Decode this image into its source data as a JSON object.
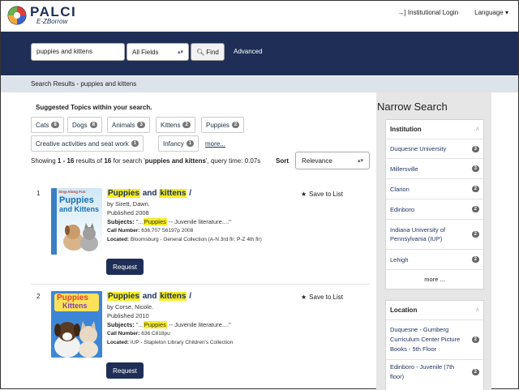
{
  "header": {
    "logo_title": "PALCI",
    "logo_subtitle": "E-ZBorrow",
    "login_label": "Institutional Login",
    "language_label": "Language"
  },
  "search": {
    "query": "puppies and kittens",
    "field": "All Fields",
    "find_label": "Find",
    "advanced_label": "Advanced"
  },
  "breadcrumb": "Search Results - puppies and kittens",
  "suggested": {
    "title": "Suggested Topics within your search.",
    "topics": [
      {
        "label": "Cats",
        "count": "8"
      },
      {
        "label": "Dogs",
        "count": "8"
      },
      {
        "label": "Animals",
        "count": "3"
      },
      {
        "label": "Kittens",
        "count": "2"
      },
      {
        "label": "Puppies",
        "count": "2"
      },
      {
        "label": "Creative activities and seat work",
        "count": "1"
      },
      {
        "label": "Infancy",
        "count": "1"
      }
    ],
    "more_label": "more..."
  },
  "results_info": {
    "showing": "Showing",
    "range": "1 - 16",
    "results_of": "results of",
    "total": "16",
    "for_search": "for search '",
    "query": "puppies and kittens",
    "query_time": "', query time: 0.07s",
    "sort_label": "Sort",
    "sort_value": "Relevance"
  },
  "results": [
    {
      "number": "1",
      "title_word1": "Puppies",
      "title_and": "and",
      "title_word2": "kittens",
      "title_end": "/",
      "author": "by Sirett, Dawn.",
      "published": "Published 2008",
      "subjects_label": "Subjects:",
      "subjects_pre": "\"...",
      "subjects_hl": "Puppies",
      "subjects_post": "-- Juvenile literature....\"",
      "call_label": "Call Number:",
      "call_value": "636.707 S6197p 2008",
      "located_label": "Located:",
      "located_value": "Bloomsburg - General Collection (A-N 3rd flr; P-Z 4th flr)",
      "save_label": "Save to List",
      "request_label": "Request",
      "cover_text": [
        "Puppies",
        "and Kittens"
      ],
      "cover_small": "Sing-Along Fun"
    },
    {
      "number": "2",
      "title_word1": "Puppies",
      "title_and": "and",
      "title_word2": "kittens",
      "title_end": "/",
      "author": "by Corse, Nicole.",
      "published": "Published 2010",
      "subjects_label": "Subjects:",
      "subjects_pre": "\"...",
      "subjects_hl": "Puppies",
      "subjects_post": "-- Juvenile literature....\"",
      "call_label": "Call Number:",
      "call_value": "636 C818pu",
      "located_label": "Located:",
      "located_value": "IUP - Stapleton Library Children's Collection",
      "save_label": "Save to List",
      "request_label": "Request",
      "cover_text": [
        "Puppies",
        "Kittens"
      ]
    }
  ],
  "sidebar": {
    "title": "Narrow Search",
    "institution": {
      "heading": "Institution",
      "items": [
        {
          "label": "Duquesne University",
          "count": "3"
        },
        {
          "label": "Millersville",
          "count": "3"
        },
        {
          "label": "Clarion",
          "count": "2"
        },
        {
          "label": "Edinboro",
          "count": "2"
        },
        {
          "label": "Indiana University of Pennsylvania (IUP)",
          "count": "2"
        },
        {
          "label": "Lehigh",
          "count": "2"
        }
      ],
      "more_label": "more ..."
    },
    "location": {
      "heading": "Location",
      "items": [
        {
          "label": "Duquesne - Gumberg Curriculum Center Picture Books - 5th Floor",
          "count": "2"
        },
        {
          "label": "Edinboro - Juvenile (7th floor)",
          "count": "2"
        }
      ]
    }
  },
  "colors": {
    "navy": "#1e2e56",
    "highlight": "#f6ee21",
    "breadcrumb_bg": "#dde3ea"
  }
}
